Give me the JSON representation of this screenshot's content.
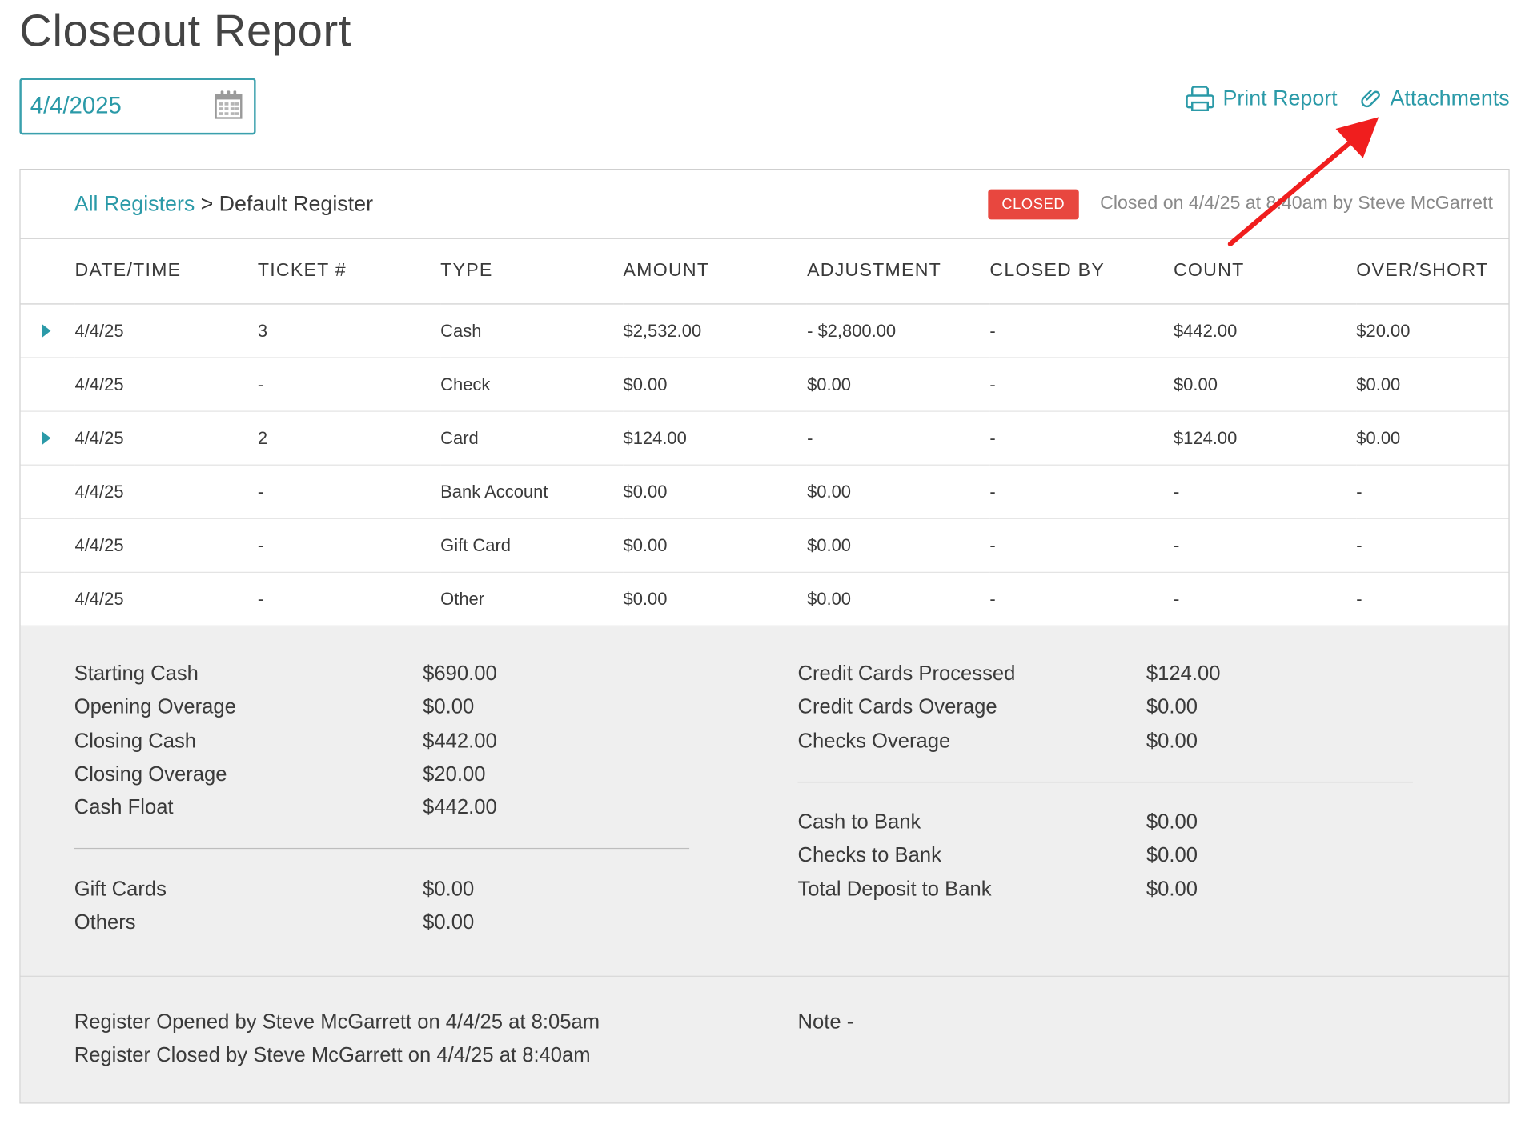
{
  "page": {
    "title": "Closeout Report"
  },
  "date_picker": {
    "value": "4/4/2025"
  },
  "actions": {
    "print_label": "Print Report",
    "attachments_label": "Attachments"
  },
  "register": {
    "breadcrumb_link": "All Registers",
    "breadcrumb_sep": ">",
    "breadcrumb_current": "Default Register",
    "status_badge": "CLOSED",
    "closed_info": "Closed on 4/4/25 at 8:40am by Steve McGarrett"
  },
  "table": {
    "headers": [
      "DATE/TIME",
      "TICKET #",
      "TYPE",
      "AMOUNT",
      "ADJUSTMENT",
      "CLOSED BY",
      "COUNT",
      "OVER/SHORT"
    ],
    "rows": [
      {
        "expandable": true,
        "cells": [
          "4/4/25",
          "3",
          "Cash",
          "$2,532.00",
          "- $2,800.00",
          "-",
          "$442.00",
          "$20.00"
        ],
        "negative_adjustment": true
      },
      {
        "expandable": false,
        "cells": [
          "4/4/25",
          "-",
          "Check",
          "$0.00",
          "$0.00",
          "-",
          "$0.00",
          "$0.00"
        ]
      },
      {
        "expandable": true,
        "cells": [
          "4/4/25",
          "2",
          "Card",
          "$124.00",
          "-",
          "-",
          "$124.00",
          "$0.00"
        ]
      },
      {
        "expandable": false,
        "cells": [
          "4/4/25",
          "-",
          "Bank Account",
          "$0.00",
          "$0.00",
          "-",
          "-",
          "-"
        ]
      },
      {
        "expandable": false,
        "cells": [
          "4/4/25",
          "-",
          "Gift Card",
          "$0.00",
          "$0.00",
          "-",
          "-",
          "-"
        ]
      },
      {
        "expandable": false,
        "cells": [
          "4/4/25",
          "-",
          "Other",
          "$0.00",
          "$0.00",
          "-",
          "-",
          "-"
        ]
      }
    ]
  },
  "summary": {
    "left_top": [
      {
        "label": "Starting Cash",
        "value": "$690.00"
      },
      {
        "label": "Opening Overage",
        "value": "$0.00"
      },
      {
        "label": "Closing Cash",
        "value": "$442.00"
      },
      {
        "label": "Closing Overage",
        "value": "$20.00"
      },
      {
        "label": "Cash Float",
        "value": "$442.00"
      }
    ],
    "left_bottom": [
      {
        "label": "Gift Cards",
        "value": "$0.00"
      },
      {
        "label": "Others",
        "value": "$0.00"
      }
    ],
    "right_top": [
      {
        "label": "Credit Cards Processed",
        "value": "$124.00"
      },
      {
        "label": "Credit Cards Overage",
        "value": "$0.00"
      },
      {
        "label": "Checks Overage",
        "value": "$0.00"
      }
    ],
    "right_bottom": [
      {
        "label": "Cash to Bank",
        "value": "$0.00"
      },
      {
        "label": "Checks to Bank",
        "value": "$0.00"
      },
      {
        "label": "Total Deposit to Bank",
        "value": "$0.00"
      }
    ]
  },
  "footer": {
    "opened_line": "Register Opened by Steve McGarrett on 4/4/25 at 8:05am",
    "closed_line": "Register Closed by Steve McGarrett on 4/4/25 at 8:40am",
    "note": "Note -"
  },
  "colors": {
    "accent": "#2b9aa8",
    "badge": "#e8473f",
    "negative": "#d0392d",
    "annotation_arrow": "#f01e1e"
  }
}
